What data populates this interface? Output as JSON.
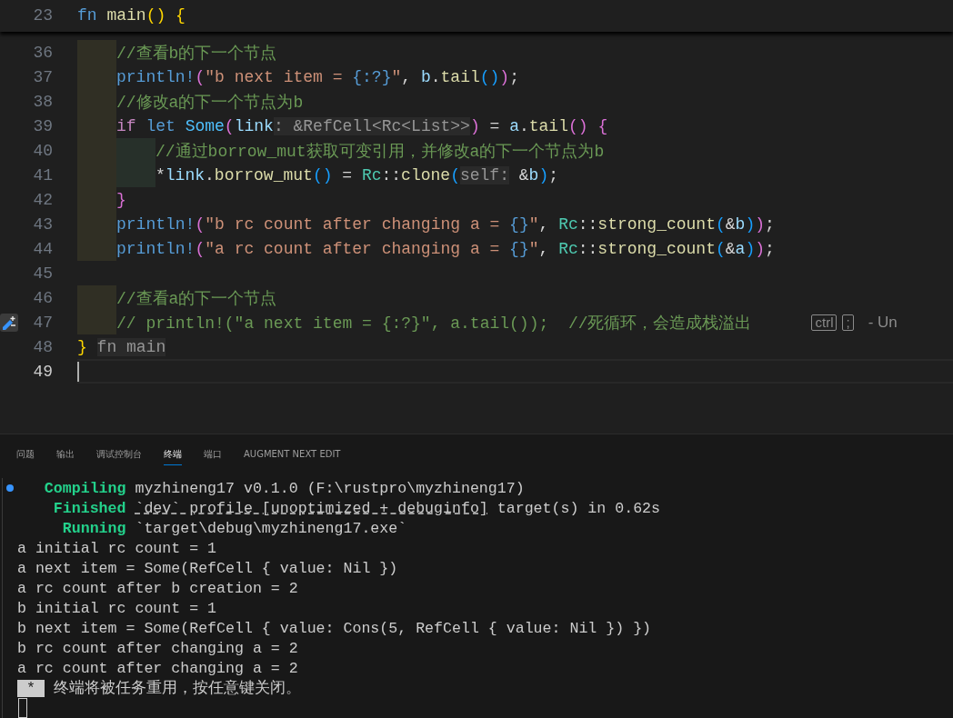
{
  "editor": {
    "sticky_line": {
      "number": "23",
      "tokens": [
        {
          "kind": "keyword",
          "text": "fn "
        },
        {
          "kind": "function",
          "text": "main"
        },
        {
          "kind": "bracket1",
          "text": "() {"
        }
      ]
    },
    "lines": [
      {
        "kind": "block",
        "children": [
          {
            "number": "36",
            "tokens": [
              {
                "kind": "comment",
                "text": "//查看b的下一个节点"
              }
            ]
          },
          {
            "number": "37",
            "tokens": [
              {
                "kind": "macro",
                "text": "println!"
              },
              {
                "kind": "bracket2",
                "text": "("
              },
              {
                "kind": "string",
                "text": "\"b next item = "
              },
              {
                "kind": "format",
                "text": "{:?}"
              },
              {
                "kind": "string",
                "text": "\""
              },
              {
                "kind": "plain",
                "text": ", "
              },
              {
                "kind": "variable",
                "text": "b"
              },
              {
                "kind": "plain",
                "text": "."
              },
              {
                "kind": "function",
                "text": "tail"
              },
              {
                "kind": "bracket3",
                "text": "()"
              },
              {
                "kind": "bracket2",
                "text": ")"
              },
              {
                "kind": "plain",
                "text": ";"
              }
            ]
          },
          {
            "number": "38",
            "tokens": [
              {
                "kind": "comment",
                "text": "//修改a的下一个节点为b"
              }
            ]
          },
          {
            "number": "39",
            "tokens": [
              {
                "kind": "control",
                "text": "if "
              },
              {
                "kind": "keyword",
                "text": "let "
              },
              {
                "kind": "enum",
                "text": "Some"
              },
              {
                "kind": "bracket2",
                "text": "("
              },
              {
                "kind": "variable",
                "text": "link"
              },
              {
                "kind": "hint",
                "text": ": &RefCell<Rc<List>>"
              },
              {
                "kind": "bracket2",
                "text": ")"
              },
              {
                "kind": "plain",
                "text": " = "
              },
              {
                "kind": "variable",
                "text": "a"
              },
              {
                "kind": "plain",
                "text": "."
              },
              {
                "kind": "function",
                "text": "tail"
              },
              {
                "kind": "bracket2",
                "text": "() {"
              }
            ]
          },
          {
            "kind": "block",
            "children": [
              {
                "number": "40",
                "tokens": [
                  {
                    "kind": "comment",
                    "text": "//通过borrow_mut获取可变引用，并修改a的下一个节点为b"
                  }
                ]
              },
              {
                "number": "41",
                "tokens": [
                  {
                    "kind": "plain",
                    "text": "*"
                  },
                  {
                    "kind": "variable",
                    "text": "link"
                  },
                  {
                    "kind": "plain",
                    "text": "."
                  },
                  {
                    "kind": "function",
                    "text": "borrow_mut"
                  },
                  {
                    "kind": "bracket3",
                    "text": "()"
                  },
                  {
                    "kind": "plain",
                    "text": " = "
                  },
                  {
                    "kind": "type",
                    "text": "Rc"
                  },
                  {
                    "kind": "plain",
                    "text": "::"
                  },
                  {
                    "kind": "function",
                    "text": "clone"
                  },
                  {
                    "kind": "bracket3",
                    "text": "("
                  },
                  {
                    "kind": "hint",
                    "text": "self:"
                  },
                  {
                    "kind": "plain",
                    "text": " &"
                  },
                  {
                    "kind": "variable",
                    "text": "b"
                  },
                  {
                    "kind": "bracket3",
                    "text": ")"
                  },
                  {
                    "kind": "plain",
                    "text": ";"
                  }
                ]
              }
            ]
          },
          {
            "number": "42",
            "tokens": [
              {
                "kind": "bracket2",
                "text": "}"
              }
            ]
          },
          {
            "number": "43",
            "tokens": [
              {
                "kind": "macro",
                "text": "println!"
              },
              {
                "kind": "bracket2",
                "text": "("
              },
              {
                "kind": "string",
                "text": "\"b rc count after changing a = "
              },
              {
                "kind": "format",
                "text": "{}"
              },
              {
                "kind": "string",
                "text": "\""
              },
              {
                "kind": "plain",
                "text": ", "
              },
              {
                "kind": "type",
                "text": "Rc"
              },
              {
                "kind": "plain",
                "text": "::"
              },
              {
                "kind": "function",
                "text": "strong_count"
              },
              {
                "kind": "bracket3",
                "text": "("
              },
              {
                "kind": "plain",
                "text": "&"
              },
              {
                "kind": "variable",
                "text": "b"
              },
              {
                "kind": "bracket3",
                "text": ")"
              },
              {
                "kind": "bracket2",
                "text": ")"
              },
              {
                "kind": "plain",
                "text": ";"
              }
            ]
          },
          {
            "number": "44",
            "tokens": [
              {
                "kind": "macro",
                "text": "println!"
              },
              {
                "kind": "bracket2",
                "text": "("
              },
              {
                "kind": "string",
                "text": "\"a rc count after changing a = "
              },
              {
                "kind": "format",
                "text": "{}"
              },
              {
                "kind": "string",
                "text": "\""
              },
              {
                "kind": "plain",
                "text": ", "
              },
              {
                "kind": "type",
                "text": "Rc"
              },
              {
                "kind": "plain",
                "text": "::"
              },
              {
                "kind": "function",
                "text": "strong_count"
              },
              {
                "kind": "bracket3",
                "text": "("
              },
              {
                "kind": "plain",
                "text": "&"
              },
              {
                "kind": "variable",
                "text": "a"
              },
              {
                "kind": "bracket3",
                "text": ")"
              },
              {
                "kind": "bracket2",
                "text": ")"
              },
              {
                "kind": "plain",
                "text": ";"
              }
            ]
          }
        ]
      },
      {
        "number": "45"
      },
      {
        "kind": "block",
        "children": [
          {
            "number": "46",
            "tokens": [
              {
                "kind": "comment",
                "text": "//查看a的下一个节点"
              }
            ]
          },
          {
            "number": "47",
            "gutter_icon": true,
            "tokens": [
              {
                "kind": "comment",
                "text": "// println!(\"a next item = {:?}\", a.tail());  //死循环，会造成栈溢出"
              }
            ],
            "hint_keys": [
              "ctrl",
              ";"
            ],
            "hint_text": "- Un"
          }
        ]
      },
      {
        "number": "48",
        "tokens": [
          {
            "kind": "bracket1",
            "text": "} "
          },
          {
            "kind": "hint",
            "text": "fn main"
          }
        ]
      },
      {
        "number": "49",
        "current": true
      }
    ]
  },
  "panel": {
    "tabs": [
      {
        "label": "问题",
        "selected": false
      },
      {
        "label": "输出",
        "selected": false
      },
      {
        "label": "调试控制台",
        "selected": false
      },
      {
        "label": "终端",
        "selected": true
      },
      {
        "label": "端口",
        "selected": false
      },
      {
        "label": "AUGMENT NEXT EDIT",
        "selected": false
      }
    ],
    "terminal_lines": [
      {
        "marker": true,
        "tokens": [
          {
            "kind": "status",
            "text": "   Compiling"
          },
          {
            "kind": "text",
            "text": " myzhineng17 v0.1.0 (F:\\rustpro\\myzhineng17)"
          }
        ]
      },
      {
        "tokens": [
          {
            "kind": "status",
            "text": "    Finished "
          },
          {
            "kind": "link",
            "text": "`dev` profile [unoptimized + debuginfo]"
          },
          {
            "kind": "text",
            "text": " target(s) in 0.62s"
          }
        ]
      },
      {
        "tokens": [
          {
            "kind": "status",
            "text": "     Running"
          },
          {
            "kind": "text",
            "text": " `target\\debug\\myzhineng17.exe`"
          }
        ]
      },
      {
        "tokens": [
          {
            "kind": "text",
            "text": "a initial rc count = 1"
          }
        ]
      },
      {
        "tokens": [
          {
            "kind": "text",
            "text": "a next item = Some(RefCell { value: Nil })"
          }
        ]
      },
      {
        "tokens": [
          {
            "kind": "text",
            "text": "a rc count after b creation = 2"
          }
        ]
      },
      {
        "tokens": [
          {
            "kind": "text",
            "text": "b initial rc count = 1"
          }
        ]
      },
      {
        "tokens": [
          {
            "kind": "text",
            "text": "b next item = Some(RefCell { value: Cons(5, RefCell { value: Nil }) })"
          }
        ]
      },
      {
        "tokens": [
          {
            "kind": "text",
            "text": "b rc count after changing a = 2"
          }
        ]
      },
      {
        "tokens": [
          {
            "kind": "text",
            "text": "a rc count after changing a = 2"
          }
        ]
      },
      {
        "tokens": [
          {
            "kind": "badge",
            "text": " * "
          },
          {
            "kind": "text",
            "text": " 终端将被任务重用，按任意键关闭。"
          }
        ]
      }
    ]
  }
}
